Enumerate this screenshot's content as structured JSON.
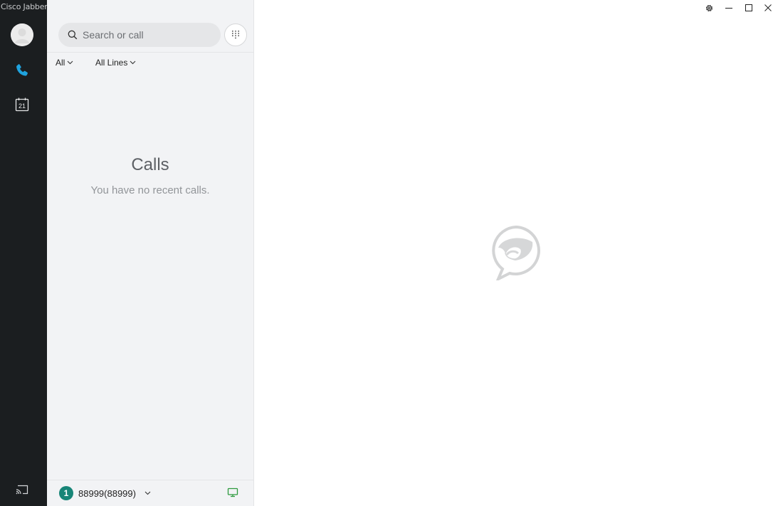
{
  "app": {
    "title": "Cisco Jabber"
  },
  "rail": {
    "items": [
      {
        "name": "avatar",
        "icon": "user-avatar-icon"
      },
      {
        "name": "calls",
        "icon": "phone-icon",
        "active": true
      },
      {
        "name": "meetings",
        "icon": "calendar-icon",
        "calendar_day": "21"
      },
      {
        "name": "screen-share",
        "icon": "cast-icon"
      }
    ],
    "accent": "#1fa3de"
  },
  "panel": {
    "search": {
      "placeholder": "Search or call",
      "value": ""
    },
    "dialpad_icon": "dialpad-icon",
    "filters": {
      "type": {
        "label": "All"
      },
      "lines": {
        "label": "All Lines"
      }
    },
    "empty_state": {
      "title": "Calls",
      "message": "You have no recent calls."
    },
    "footer": {
      "line_badge": "1",
      "line_number": "88999(88999)",
      "device_icon": "desktop-icon",
      "badge_color": "#178577",
      "device_color": "#2e9a3e"
    }
  },
  "window_controls": {
    "settings": "gear-icon",
    "minimize": "minimize-icon",
    "maximize": "maximize-icon",
    "close": "close-icon"
  },
  "main": {
    "watermark": "jabber-logo-icon"
  }
}
